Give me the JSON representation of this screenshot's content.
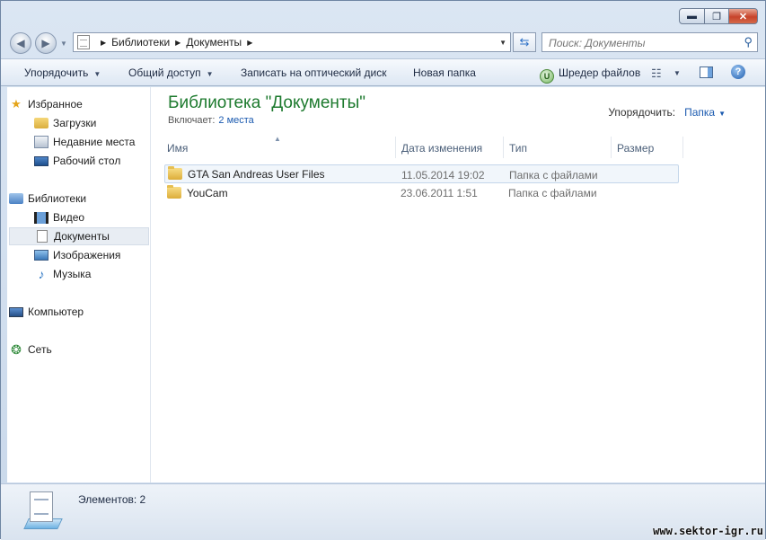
{
  "window": {
    "controls": {
      "minimize": "▬",
      "maximize": "❐",
      "close": "✕"
    }
  },
  "nav": {
    "back_glyph": "◀",
    "forward_glyph": "▶",
    "breadcrumb": [
      "Библиотеки",
      "Документы"
    ],
    "search_placeholder": "Поиск: Документы",
    "refresh_glyph": "⇆",
    "search_glyph": "⚲"
  },
  "toolbar": {
    "organize": "Упорядочить",
    "share": "Общий доступ",
    "burn": "Записать на оптический диск",
    "new_folder": "Новая папка",
    "shredder": "Шредер файлов",
    "shredder_icon_glyph": "U",
    "views_glyph": "☷",
    "help_glyph": "?"
  },
  "sidebar": {
    "favorites": {
      "label": "Избранное",
      "items": [
        "Загрузки",
        "Недавние места",
        "Рабочий стол"
      ]
    },
    "libraries": {
      "label": "Библиотеки",
      "items": [
        "Видео",
        "Документы",
        "Изображения",
        "Музыка"
      ],
      "selected": "Документы"
    },
    "computer": "Компьютер",
    "network": "Сеть",
    "icons": {
      "star": "★",
      "music": "♪",
      "network": "❂"
    }
  },
  "content": {
    "title": "Библиотека \"Документы\"",
    "includes_label": "Включает:",
    "includes_link": "2 места",
    "arrange_label": "Упорядочить:",
    "arrange_value": "Папка",
    "columns": {
      "name": "Имя",
      "date": "Дата изменения",
      "type": "Тип",
      "size": "Размер"
    },
    "sort_glyph": "▲",
    "files": [
      {
        "name": "GTA San Andreas User Files",
        "date": "11.05.2014 19:02",
        "type": "Папка с файлами",
        "size": ""
      },
      {
        "name": "YouCam",
        "date": "23.06.2011 1:51",
        "type": "Папка с файлами",
        "size": ""
      }
    ]
  },
  "status": {
    "count": "Элементов: 2"
  },
  "watermark": "www.sektor-igr.ru"
}
